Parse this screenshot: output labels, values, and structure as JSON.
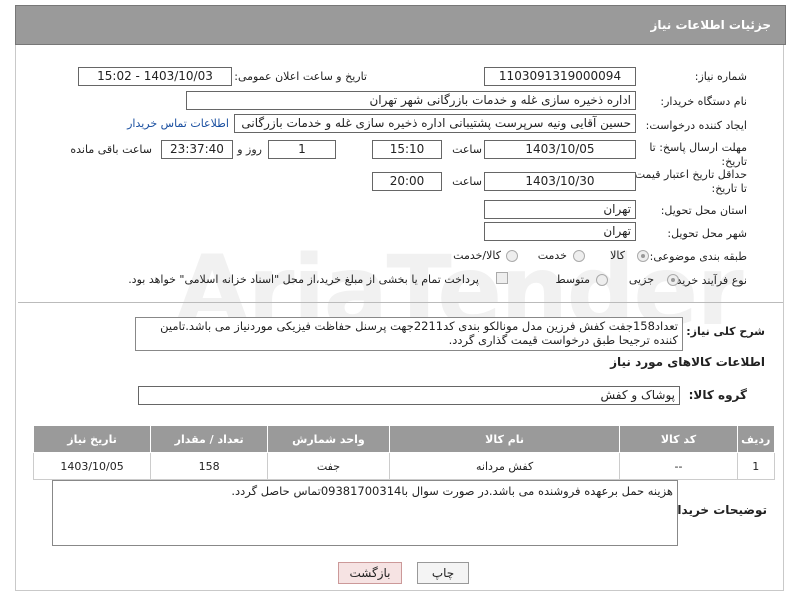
{
  "header": {
    "title": "جزئیات اطلاعات نیاز"
  },
  "fields": {
    "need_number_label": "شماره نیاز:",
    "need_number": "1103091319000094",
    "announce_label": "تاریخ و ساعت اعلان عمومی:",
    "announce_value": "1403/10/03 - 15:02",
    "buyer_label": "نام دستگاه خریدار:",
    "buyer_value": "اداره ذخیره سازی غله و خدمات بازرگانی شهر تهران",
    "creator_label": "ایجاد کننده درخواست:",
    "creator_value": "حسین آقایی ونیه سرپرست پشتیبانی اداره ذخیره سازی غله و خدمات بازرگانی",
    "contact_link": "اطلاعات تماس خریدار",
    "reply_label": "مهلت ارسال پاسخ: تا تاریخ:",
    "reply_date": "1403/10/05",
    "time_word": "ساعت",
    "reply_time": "15:10",
    "days_value": "1",
    "days_word": "روز و",
    "remain_time": "23:37:40",
    "remain_word": "ساعت باقی مانده",
    "validity_label": "حداقل تاریخ اعتبار قیمت: تا تاریخ:",
    "validity_date": "1403/10/30",
    "validity_time": "20:00",
    "province_label": "استان محل تحویل:",
    "province_value": "تهران",
    "city_label": "شهر محل تحویل:",
    "city_value": "تهران",
    "category_label": "طبقه بندی موضوعی:",
    "category_options": [
      "کالا",
      "خدمت",
      "کالا/خدمت"
    ],
    "category_selected": "کالا",
    "purchase_label": "نوع فرآیند خرید :",
    "purchase_options": [
      "جزیی",
      "متوسط"
    ],
    "purchase_selected": "جزیی",
    "purchase_note": "پرداخت تمام یا بخشی از مبلغ خرید،از محل \"اسناد خزانه اسلامی\" خواهد بود."
  },
  "description": {
    "label": "شرح کلی نیاز:",
    "text": "تعداد158جفت کفش فرزین مدل مونالکو بندی کد2211جهت پرسنل حفاظت فیزیکی موردنیاز می باشد.تامین کننده ترجیحا طبق درخواست قیمت گذاری گردد."
  },
  "goods": {
    "section_title": "اطلاعات کالاهای مورد نیاز",
    "group_label": "گروه کالا:",
    "group_value": "پوشاک و کفش",
    "columns": [
      "ردیف",
      "کد کالا",
      "نام کالا",
      "واحد شمارش",
      "تعداد / مقدار",
      "تاریخ نیاز"
    ],
    "rows": [
      {
        "row": "1",
        "code": "--",
        "name": "کفش مردانه",
        "unit": "جفت",
        "qty": "158",
        "date": "1403/10/05"
      }
    ]
  },
  "buyer_notes": {
    "label": "توضیحات خریدار:",
    "text": "هزینه حمل برعهده فروشنده می باشد.در صورت سوال با09381700314تماس حاصل گردد."
  },
  "buttons": {
    "print": "چاپ",
    "back": "بازگشت"
  },
  "colors": {
    "header_bg": "#9a9a9a",
    "link": "#1a4fa0",
    "back_btn_bg": "#f6e3e3"
  }
}
